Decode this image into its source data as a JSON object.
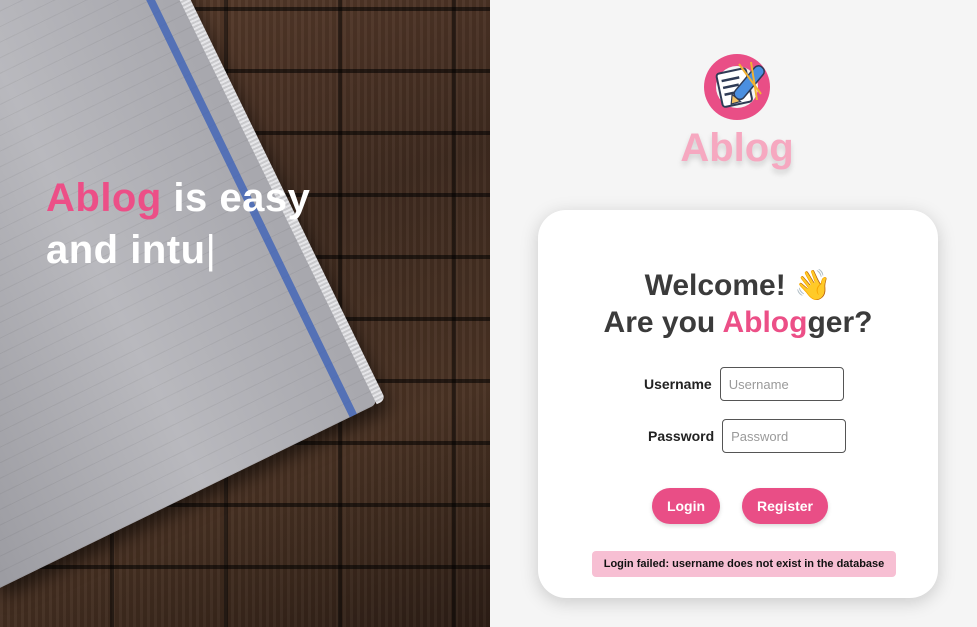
{
  "hero": {
    "accent_word": "Ablog",
    "text_line1_rest": " is easy",
    "text_line2": "and intu",
    "cursor": "|"
  },
  "brand": {
    "name": "Ablog",
    "icon": "notebook-pencil-logo-icon"
  },
  "login": {
    "welcome": "Welcome!",
    "wave_emoji": "👋",
    "question_prefix": "Are you ",
    "question_accent": "Ablog",
    "question_suffix": "ger?",
    "username_label": "Username",
    "username_placeholder": "Username",
    "username_value": "",
    "password_label": "Password",
    "password_placeholder": "Password",
    "password_value": "",
    "login_button": "Login",
    "register_button": "Register",
    "error_message": "Login failed: username does not exist in the database"
  },
  "colors": {
    "accent": "#e94e86",
    "brand_light": "#f6a8c0",
    "error_bg": "#f7bfd3"
  }
}
